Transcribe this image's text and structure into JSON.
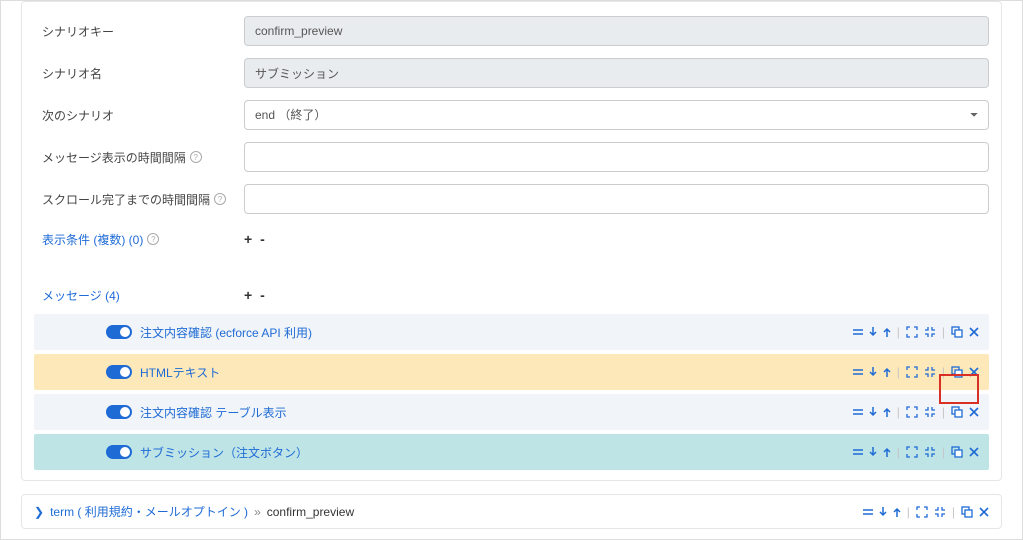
{
  "labels": {
    "scenario_key": "シナリオキー",
    "scenario_name": "シナリオ名",
    "next_scenario": "次のシナリオ",
    "msg_interval": "メッセージ表示の時間間隔",
    "scroll_wait": "スクロール完了までの時間間隔",
    "conditions": "表示条件 (複数) (0)",
    "messages": "メッセージ (4)"
  },
  "values": {
    "scenario_key": "confirm_preview",
    "scenario_name": "サブミッション",
    "next_scenario": "end （終了）",
    "msg_interval": "",
    "scroll_wait": ""
  },
  "plusminus": "+ -",
  "messages": [
    {
      "title": "注文内容確認 (ecforce API 利用)",
      "bg": "gray"
    },
    {
      "title": "HTMLテキスト",
      "bg": "yellow"
    },
    {
      "title": "注文内容確認 テーブル表示",
      "bg": "gray",
      "highlighted": true
    },
    {
      "title": "サブミッション（注文ボタン）",
      "bg": "teal"
    }
  ],
  "footer": {
    "link": "term ( 利用規約・メールオプトイン )",
    "sep": "»",
    "current": "confirm_preview"
  },
  "colors": {
    "link": "#1e6bd6",
    "danger": "#d93025"
  }
}
